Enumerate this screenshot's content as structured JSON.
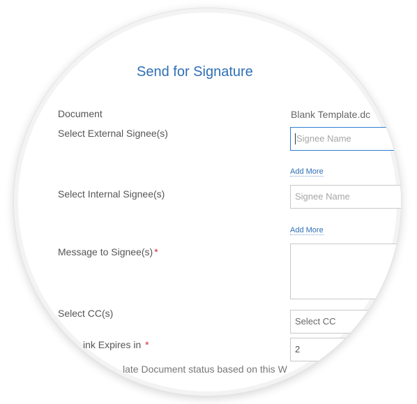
{
  "dialog": {
    "title": "Send for Signature"
  },
  "form": {
    "document": {
      "label": "Document",
      "value": "Blank Template.dc"
    },
    "external_signees": {
      "label": "Select External Signee(s)",
      "placeholder": "Signee Name",
      "add_more": "Add More"
    },
    "internal_signees": {
      "label": "Select Internal Signee(s)",
      "placeholder": "Signee Name",
      "add_more": "Add More"
    },
    "message": {
      "label": "Message to Signee(s)",
      "required_mark": "*",
      "value": ""
    },
    "cc": {
      "label": "Select CC(s)",
      "placeholder": "Select CC"
    },
    "link_expires": {
      "label": "ink Expires in",
      "required_mark": "*",
      "value": "2"
    },
    "update_status": {
      "label": "late Document status based on this W"
    }
  },
  "colors": {
    "title": "#2f6fb6",
    "required": "#d12f2f",
    "active_border": "#2f7bd1"
  }
}
